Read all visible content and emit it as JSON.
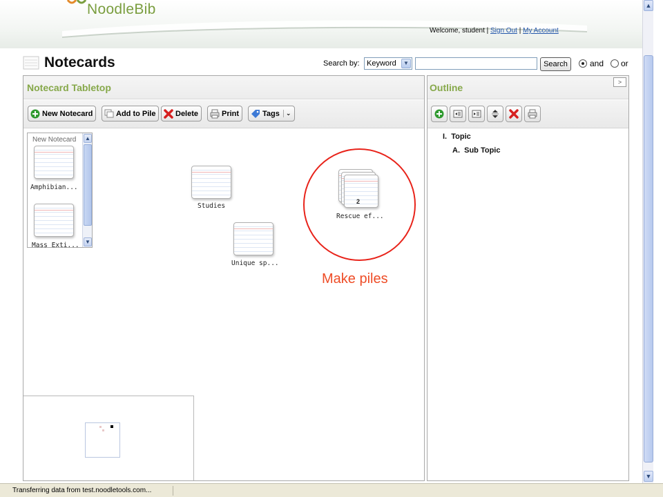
{
  "header": {
    "logo_text": "NoodleBib",
    "welcome_prefix": "Welcome, student |",
    "sign_out": "Sign Out",
    "sep": "|",
    "my_account": "My Account"
  },
  "page_title": "Notecards",
  "search": {
    "label": "Search by:",
    "selected": "Keyword",
    "query": "",
    "button": "Search",
    "and_label": "and",
    "or_label": "or",
    "and_selected": true
  },
  "tabletop": {
    "title": "Notecard Tabletop",
    "buttons": {
      "new_notecard": "New Notecard",
      "add_to_pile": "Add to Pile",
      "delete": "Delete",
      "print": "Print",
      "tags": "Tags"
    },
    "sidebox_title": "New Notecard",
    "sidebox_cards": [
      "Amphibian...",
      "Mass Exti..."
    ],
    "cards": [
      "Studies",
      "Unique sp..."
    ],
    "pile": {
      "label": "Rescue ef...",
      "count": "2"
    },
    "annotation": "Make piles"
  },
  "outline": {
    "title": "Outline",
    "items": [
      {
        "marker": "I.",
        "text": "Topic"
      },
      {
        "marker": "A.",
        "text": "Sub Topic"
      }
    ]
  },
  "status_text": "Transferring data from test.noodletools.com...",
  "colors": {
    "panel_title": "#86a84a",
    "annotation": "#e8231a",
    "link": "#2255aa"
  }
}
